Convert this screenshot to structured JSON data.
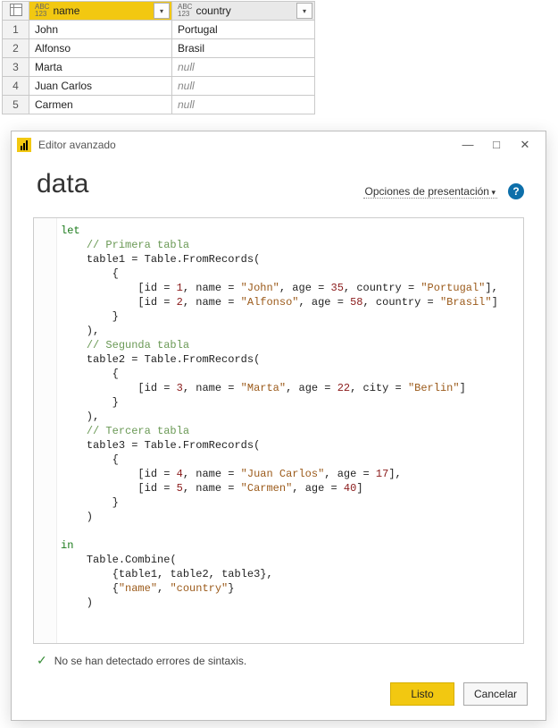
{
  "table": {
    "columns": [
      {
        "type_l1": "ABC",
        "type_l2": "123",
        "name": "name",
        "selected": true
      },
      {
        "type_l1": "ABC",
        "type_l2": "123",
        "name": "country",
        "selected": false
      }
    ],
    "rows": [
      {
        "num": "1",
        "name": "John",
        "country": "Portugal"
      },
      {
        "num": "2",
        "name": "Alfonso",
        "country": "Brasil"
      },
      {
        "num": "3",
        "name": "Marta",
        "country": null
      },
      {
        "num": "4",
        "name": "Juan Carlos",
        "country": null
      },
      {
        "num": "5",
        "name": "Carmen",
        "country": null
      }
    ],
    "null_text": "null"
  },
  "editor": {
    "title": "Editor avanzado",
    "query_name": "data",
    "display_options": "Opciones de presentación",
    "help_glyph": "?",
    "win": {
      "min": "—",
      "max": "□",
      "close": "✕"
    },
    "status_text": "No se han detectado errores de sintaxis.",
    "buttons": {
      "ok": "Listo",
      "cancel": "Cancelar"
    },
    "code_tokens": {
      "let": "let",
      "in": "in",
      "c_t1": "// Primera tabla",
      "c_t2": "// Segunda tabla",
      "c_t3": "// Tercera tabla",
      "from_records": "Table.FromRecords",
      "combine": "Table.Combine",
      "t1": "table1",
      "t2": "table2",
      "t3": "table3",
      "id": "id",
      "name": "name",
      "age": "age",
      "country": "country",
      "city": "city",
      "n1": "1",
      "n2": "2",
      "n3": "3",
      "n4": "4",
      "n5": "5",
      "a35": "35",
      "a58": "58",
      "a22": "22",
      "a17": "17",
      "a40": "40",
      "s_john": "\"John\"",
      "s_alfonso": "\"Alfonso\"",
      "s_marta": "\"Marta\"",
      "s_juan": "\"Juan Carlos\"",
      "s_carmen": "\"Carmen\"",
      "s_portugal": "\"Portugal\"",
      "s_brasil": "\"Brasil\"",
      "s_berlin": "\"Berlin\"",
      "s_name": "\"name\"",
      "s_country": "\"country\""
    }
  }
}
